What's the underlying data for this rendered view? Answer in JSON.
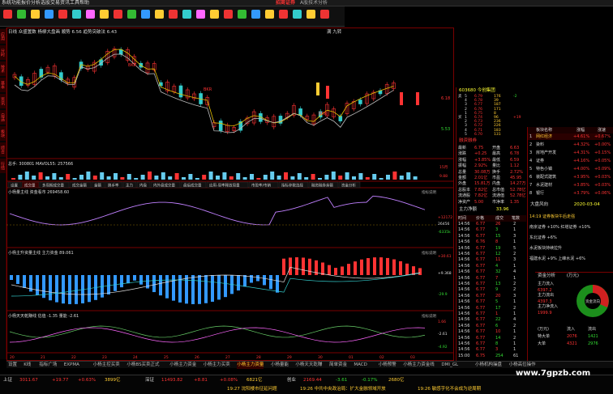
{
  "window": {
    "menu": [
      "系统",
      "功能",
      "报价",
      "分析",
      "选股",
      "交易",
      "资讯",
      "工具",
      "帮助"
    ],
    "title": "招商证券",
    "subtitle": "A股技术分析"
  },
  "toolbar": {
    "colors": [
      "#e33",
      "#3b3",
      "#fc3",
      "#39f",
      "#e33",
      "#3cc",
      "#f6f",
      "#fc3",
      "#e33",
      "#3b3",
      "#39f",
      "#fc3",
      "#e33",
      "#3cc",
      "#f6f",
      "#fc3",
      "#e33",
      "#3b3",
      "#39f",
      "#fc3",
      "#e33",
      "#3cc",
      "#fc3",
      "#e33"
    ]
  },
  "left_tabs": [
    "应用",
    "分时",
    "技术",
    "基本",
    "资讯",
    "自选",
    "板块",
    "综合",
    "行情"
  ],
  "main_chart": {
    "header": "日线  众盛置数  杨柳大盘画 顺势 6.56  趋势突破法 6.43",
    "label_top_right": "满 九转",
    "price_marks": [
      "6.18",
      "5.53"
    ],
    "annotations": [
      "BKR",
      "BKR",
      "BKR"
    ]
  },
  "volume_panel": {
    "header": "总手: 300801  MAVOL55: 257566",
    "right_marks": [
      "15月",
      "9.88"
    ]
  },
  "indicator_tabs": [
    "设置",
    "成交量",
    "多周期成交量",
    "成交金额",
    "金额",
    "换手率",
    "主力",
    "内盘",
    "内外盘成交量",
    "盘后成交量",
    "应用-周率释放周量",
    "市盈率/市销",
    "指标参数选择",
    "融资融券余额",
    "资金分析"
  ],
  "indicator1": {
    "header": "小杨量主线  资金看市 269458.60",
    "tag": "指标说明",
    "marks": [
      "+12172",
      "26456",
      "-6335k"
    ]
  },
  "indicator2": {
    "header": "小杨主升资量主线  主力资金 89.061",
    "tag": "指标说明",
    "marks": [
      "+30.61",
      "+9.368",
      "-29.9"
    ]
  },
  "indicator3": {
    "header": "小杨天天乾赚线  估值 -1.35  量能 -2.61",
    "tag": "指标说明",
    "marks": [
      "1.66",
      "-2.61",
      "-4.92"
    ]
  },
  "x_axis": [
    "20",
    "21",
    "22",
    "23",
    "24",
    "25",
    "26",
    "27",
    "28",
    "29",
    "30",
    "01",
    "02",
    "03"
  ],
  "bottom_tabs": [
    "设置",
    "K线",
    "指标广场",
    "EXPMA",
    "小杨主控买卖",
    "小杨BS买卖正式",
    "小杨主力资金",
    "小杨主力买卖",
    "小杨主力资量",
    "小杨量能",
    "小杨天天乾赚",
    "简单资金",
    "MACD",
    "小杨预警",
    "小杨主力资金线",
    "DMI_GL",
    "小杨机构操盘",
    "小杨高位操作"
  ],
  "stock_header": {
    "code": "603680",
    "name": "今创集团",
    "tag": "融资融券"
  },
  "orderbook": [
    {
      "label": "卖",
      "level": "5",
      "price": "6.79",
      "vol": "176",
      "chg": "-2"
    },
    {
      "label": "",
      "level": "4",
      "price": "6.78",
      "vol": "39",
      "chg": ""
    },
    {
      "label": "",
      "level": "3",
      "price": "6.77",
      "vol": "187",
      "chg": ""
    },
    {
      "label": "",
      "level": "2",
      "price": "6.76",
      "vol": "171",
      "chg": ""
    },
    {
      "label": "",
      "level": "1",
      "price": "6.75",
      "vol": "8",
      "chg": ""
    },
    {
      "label": "买",
      "level": "1",
      "price": "6.74",
      "vol": "96",
      "chg": "+19"
    },
    {
      "label": "",
      "level": "2",
      "price": "6.73",
      "vol": "236",
      "chg": ""
    },
    {
      "label": "",
      "level": "3",
      "price": "6.72",
      "vol": "226",
      "chg": ""
    },
    {
      "label": "",
      "level": "4",
      "price": "6.71",
      "vol": "183",
      "chg": ""
    },
    {
      "label": "",
      "level": "5",
      "price": "6.70",
      "vol": "131",
      "chg": ""
    }
  ],
  "stats": [
    [
      "最新",
      "6.75",
      "开盘",
      "6.63"
    ],
    [
      "涨跌",
      "+0.25",
      "最高",
      "6.78"
    ],
    [
      "涨幅",
      "+3.85%",
      "最低",
      "6.59"
    ],
    [
      "振幅",
      "2.92%",
      "量比",
      "1.12"
    ],
    [
      "总量",
      "30.08万",
      "换手",
      "2.72%"
    ],
    [
      "金额",
      "2.01亿",
      "市盈",
      "45.95"
    ],
    [
      "外盘",
      "15.81万",
      "内盘",
      "14.27万"
    ],
    [
      "总股本",
      "7.82亿",
      "总市值",
      "52.78亿"
    ],
    [
      "流通股",
      "7.82亿",
      "流通值",
      "52.78亿"
    ],
    [
      "净资产",
      "5.00",
      "市净率",
      "1.35"
    ]
  ],
  "market_summary": {
    "label": "主力净额",
    "value": "33.96"
  },
  "ticks_header": [
    "时间",
    "价格",
    "成交",
    "笔数"
  ],
  "ticks": [
    [
      "14:56",
      "6.77",
      "26",
      "2"
    ],
    [
      "14:56",
      "6.77",
      "3",
      "1"
    ],
    [
      "14:56",
      "6.77",
      "15",
      "3"
    ],
    [
      "14:56",
      "6.76",
      "8",
      "1"
    ],
    [
      "14:56",
      "6.77",
      "19",
      "5"
    ],
    [
      "14:56",
      "6.77",
      "12",
      "2"
    ],
    [
      "14:56",
      "6.77",
      "11",
      "3"
    ],
    [
      "14:56",
      "6.77",
      "4",
      "1"
    ],
    [
      "14:56",
      "6.77",
      "32",
      "4"
    ],
    [
      "14:56",
      "6.77",
      "7",
      "1"
    ],
    [
      "14:56",
      "6.77",
      "13",
      "2"
    ],
    [
      "14:56",
      "6.77",
      "9",
      "2"
    ],
    [
      "14:56",
      "6.77",
      "20",
      "3"
    ],
    [
      "14:56",
      "6.77",
      "5",
      "1"
    ],
    [
      "14:56",
      "6.77",
      "17",
      "2"
    ],
    [
      "14:56",
      "6.77",
      "1",
      "1"
    ],
    [
      "14:56",
      "6.77",
      "22",
      "4"
    ],
    [
      "14:56",
      "6.77",
      "6",
      "2"
    ],
    [
      "14:56",
      "6.77",
      "10",
      "1"
    ],
    [
      "14:56",
      "6.77",
      "14",
      "2"
    ],
    [
      "14:56",
      "6.77",
      "8",
      "1"
    ],
    [
      "14:56",
      "6.77",
      "3",
      "1"
    ],
    [
      "15:00",
      "6.75",
      "254",
      "61"
    ]
  ],
  "sector_header": [
    "板块名称",
    "涨幅",
    "涨速"
  ],
  "sectors": [
    {
      "idx": "1",
      "name": "网红经济",
      "chg": "+4.61%",
      "speed": "+0.67%"
    },
    {
      "idx": "2",
      "name": "染料",
      "chg": "+4.32%",
      "speed": "+0.00%"
    },
    {
      "idx": "3",
      "name": "房地产开发",
      "chg": "+4.31%",
      "speed": "+0.15%"
    },
    {
      "idx": "4",
      "name": "证券",
      "chg": "+4.16%",
      "speed": "+0.05%"
    },
    {
      "idx": "5",
      "name": "特色小镇",
      "chg": "+4.00%",
      "speed": "+0.09%"
    },
    {
      "idx": "6",
      "name": "装配式建筑",
      "chg": "+3.95%",
      "speed": "+0.03%"
    },
    {
      "idx": "7",
      "name": "水泥建材",
      "chg": "+3.85%",
      "speed": "+0.03%"
    },
    {
      "idx": "8",
      "name": "银行",
      "chg": "+3.79%",
      "speed": "+0.06%"
    }
  ],
  "sector_footer": {
    "label": "大盘风向",
    "date": "2020-03-04"
  },
  "news": [
    "14:19 证券板块午后走强",
    "南京证券 +10%  红塔证券 +10%",
    "东北证券 +6%",
    "水泥板块持续拉升",
    "福建水泥 +9%  上峰水泥 +6%"
  ],
  "fund_panel": {
    "title": "资金分析",
    "unit": "(万元)",
    "rows": [
      {
        "label": "主力流入",
        "value": "6397.2"
      },
      {
        "label": "主力流出",
        "value": "4397.3"
      },
      {
        "label": "主力净流入",
        "value": "1999.9"
      }
    ],
    "pie_label": "资金流向",
    "table_header": [
      "(万元)",
      "流入",
      "流出"
    ],
    "table_rows": [
      [
        "特大单",
        "2076",
        "1421"
      ],
      [
        "大单",
        "4321",
        "2976"
      ]
    ]
  },
  "statusbar": {
    "indices": [
      {
        "name": "上证",
        "value": "3011.67",
        "chg": "+19.77",
        "pct": "+0.63%",
        "amt": "3899亿"
      },
      {
        "name": "深证",
        "value": "11493.82",
        "chg": "+8.81",
        "pct": "+0.08%",
        "amt": "6821亿"
      },
      {
        "name": "创业",
        "value": "2169.44",
        "chg": "-3.61",
        "pct": "-0.17%",
        "amt": "2680亿"
      }
    ],
    "news1": "19:27 沈阳楼市征延问题",
    "news2": "19:26 中共中央政治局：扩大金融领域开放",
    "news3": "19:26 敏感字化不会成为逆周期",
    "watermark": "www.7gpzb.com"
  }
}
